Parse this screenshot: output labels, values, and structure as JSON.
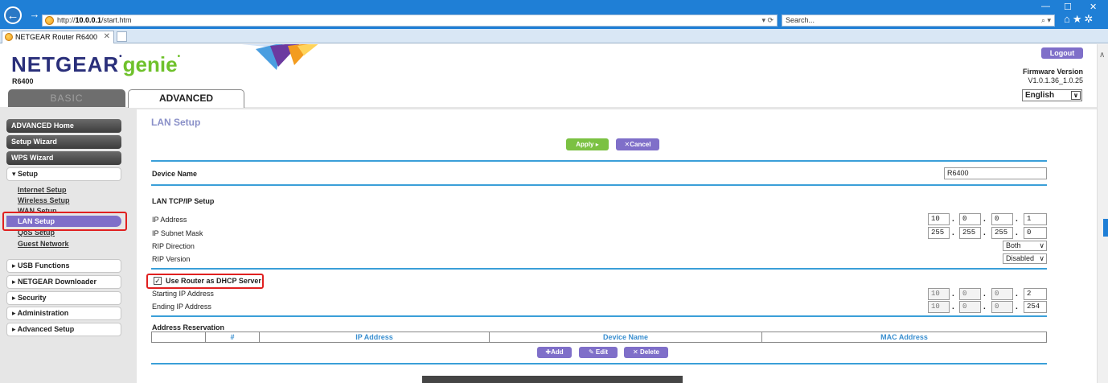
{
  "browser": {
    "url_prefix": "http://",
    "url_host": "10.0.0.1",
    "url_path": "/start.htm",
    "addr_tools": "▾ ⟳",
    "search_placeholder": "Search...",
    "search_icon": "⌕ ▾",
    "win_min": "—",
    "win_max": "☐",
    "win_close": "✕",
    "tool_icons": "⌂★✲",
    "tab_title": "NETGEAR Router R6400",
    "tab_close": "✕"
  },
  "header": {
    "logo_main": "NETGEAR",
    "logo_genie": "genie",
    "model": "R6400",
    "logout_label": "Logout",
    "firmware_label": "Firmware Version",
    "firmware_version": "V1.0.1.36_1.0.25",
    "language": "English"
  },
  "tabs": {
    "basic": "BASIC",
    "advanced": "ADVANCED"
  },
  "sidebar": {
    "advanced_home": "ADVANCED Home",
    "setup_wizard": "Setup Wizard",
    "wps_wizard": "WPS Wizard",
    "setup": "▾ Setup",
    "setup_items": {
      "internet": "Internet Setup",
      "wireless": "Wireless Setup",
      "wan": "WAN Setup",
      "lan": "LAN Setup",
      "qos": "QoS Setup",
      "guest": "Guest Network"
    },
    "usb": "▸ USB Functions",
    "downloader": "▸ NETGEAR Downloader",
    "security": "▸ Security",
    "administration": "▸ Administration",
    "advanced_setup": "▸ Advanced Setup"
  },
  "main": {
    "title": "LAN Setup",
    "apply_label": "Apply ▸",
    "cancel_label": "✕Cancel",
    "device_name_label": "Device Name",
    "device_name_value": "R6400",
    "tcpip_label": "LAN TCP/IP Setup",
    "ip_label": "IP Address",
    "ip": [
      "10",
      "0",
      "0",
      "1"
    ],
    "mask_label": "IP Subnet Mask",
    "mask": [
      "255",
      "255",
      "255",
      "0"
    ],
    "rip_dir_label": "RIP Direction",
    "rip_dir_value": "Both",
    "rip_ver_label": "RIP Version",
    "rip_ver_value": "Disabled",
    "dhcp_label": "Use Router as DHCP Server",
    "dhcp_checked": "✓",
    "start_label": "Starting IP Address",
    "start_ip": [
      "10",
      "0",
      "0",
      "2"
    ],
    "end_label": "Ending IP Address",
    "end_ip": [
      "10",
      "0",
      "0",
      "254"
    ],
    "reservation_label": "Address Reservation",
    "columns": [
      "#",
      "IP Address",
      "Device Name",
      "MAC Address"
    ],
    "add_label": "✚Add",
    "edit_label": "✎ Edit",
    "delete_label": "✕ Delete"
  },
  "colors": {
    "accent_purple": "#7f6fc9",
    "accent_green": "#7bc142",
    "accent_blue": "#3a9fd8",
    "highlight_red": "#e02020"
  }
}
